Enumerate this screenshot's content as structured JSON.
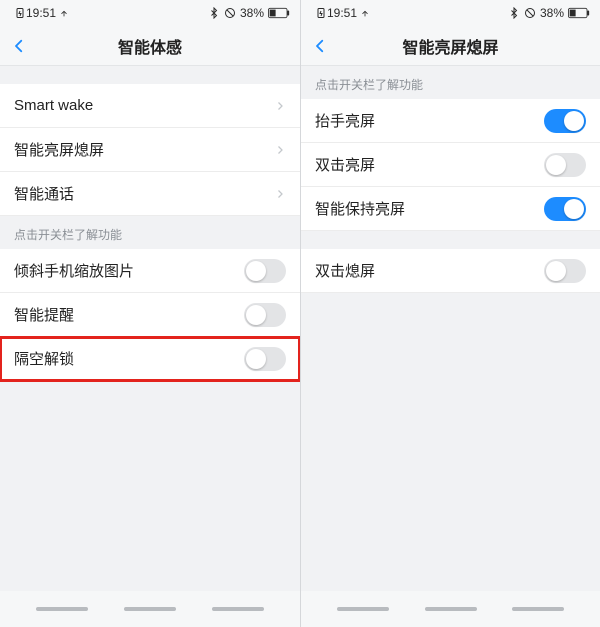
{
  "status": {
    "time": "19:51",
    "battery_percent": "38%"
  },
  "left": {
    "title": "智能体感",
    "nav_rows": [
      {
        "label": "Smart wake"
      },
      {
        "label": "智能亮屏熄屏"
      },
      {
        "label": "智能通话"
      }
    ],
    "hint": "点击开关栏了解功能",
    "toggle_rows": [
      {
        "label": "倾斜手机缩放图片",
        "on": false,
        "highlight": false
      },
      {
        "label": "智能提醒",
        "on": false,
        "highlight": false
      },
      {
        "label": "隔空解锁",
        "on": false,
        "highlight": true
      }
    ]
  },
  "right": {
    "title": "智能亮屏熄屏",
    "hint": "点击开关栏了解功能",
    "group1": [
      {
        "label": "抬手亮屏",
        "on": true
      },
      {
        "label": "双击亮屏",
        "on": false
      },
      {
        "label": "智能保持亮屏",
        "on": true
      }
    ],
    "group2": [
      {
        "label": "双击熄屏",
        "on": false
      }
    ]
  },
  "colors": {
    "accent": "#1d8cff",
    "highlight": "#e3231d"
  }
}
